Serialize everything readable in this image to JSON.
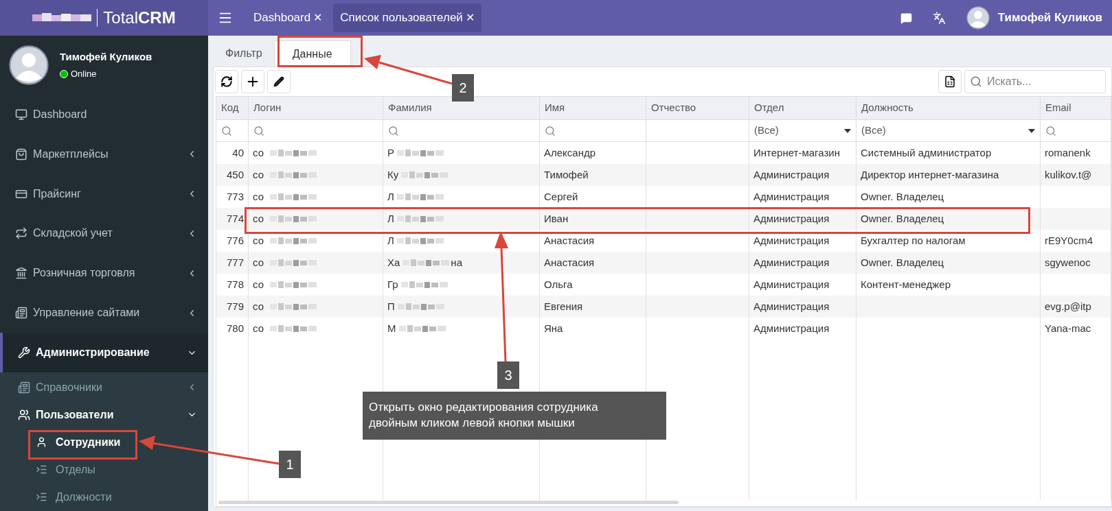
{
  "header": {
    "brand": "Total**CRM**",
    "tabs": [
      {
        "label": "Dashboard",
        "close": "✕",
        "selected": false
      },
      {
        "label": "Список пользователей",
        "close": "✕",
        "selected": true
      }
    ],
    "user": "Тимофей Куликов"
  },
  "sidebar": {
    "user": {
      "name": "Тимофей Куликов",
      "status": "Online"
    },
    "items": [
      {
        "label": "Dashboard"
      },
      {
        "label": "Маркетплейсы",
        "expanded": false
      },
      {
        "label": "Прайсинг",
        "expanded": false
      },
      {
        "label": "Складской учет",
        "expanded": false
      },
      {
        "label": "Розничная торговля",
        "expanded": false
      },
      {
        "label": "Управление сайтами",
        "expanded": false
      },
      {
        "label": "Администрирование",
        "expanded": true,
        "selected": true,
        "children": [
          {
            "label": "Справочники",
            "expanded": false,
            "selected": false
          },
          {
            "label": "Пользователи",
            "expanded": true,
            "selected": false,
            "children": [
              {
                "label": "Сотрудники",
                "selected": true
              },
              {
                "label": "Отделы",
                "selected": false
              },
              {
                "label": "Должности",
                "selected": false
              }
            ]
          }
        ]
      }
    ]
  },
  "page_tabs": [
    {
      "label": "Фильтр",
      "selected": false
    },
    {
      "label": "Данные",
      "selected": true
    }
  ],
  "search": {
    "placeholder": "Искать..."
  },
  "table": {
    "columns": [
      {
        "label": "Код",
        "filter": {
          "kind": "search"
        }
      },
      {
        "label": "Логин",
        "filter": {
          "kind": "search"
        }
      },
      {
        "label": "Фамилия",
        "filter": {
          "kind": "search"
        }
      },
      {
        "label": "Имя",
        "filter": {
          "kind": "search"
        }
      },
      {
        "label": "Отчество"
      },
      {
        "label": "Отдел",
        "filter": {
          "kind": "select",
          "value": "(Все)"
        }
      },
      {
        "label": "Должность",
        "filter": {
          "kind": "select",
          "value": "(Все)"
        }
      },
      {
        "label": "Email",
        "filter": {
          "kind": "search"
        }
      }
    ],
    "rows": [
      {
        "cells": [
          {
            "text": "40"
          },
          {
            "text": "со",
            "redacted": true
          },
          {
            "text": "Р",
            "redacted": true
          },
          {
            "text": "Александр"
          },
          {},
          {
            "text": "Интернет-магазин"
          },
          {
            "text": "Системный администратор"
          },
          {
            "text": "romanenk"
          }
        ]
      },
      {
        "cells": [
          {
            "text": "450"
          },
          {
            "text": "со",
            "redacted": true
          },
          {
            "text": "Ку",
            "redacted": true
          },
          {
            "text": "Тимофей"
          },
          {},
          {
            "text": "Администрация"
          },
          {
            "text": "Директор интернет-магазина"
          },
          {
            "text": "kulikov.t@"
          }
        ]
      },
      {
        "cells": [
          {
            "text": "773"
          },
          {
            "text": "со",
            "redacted": true
          },
          {
            "text": "Л",
            "redacted": true
          },
          {
            "text": "Сергей"
          },
          {},
          {
            "text": "Администрация"
          },
          {
            "text": "Owner. Владелец"
          },
          {}
        ]
      },
      {
        "cells": [
          {
            "text": "774"
          },
          {
            "text": "со",
            "redacted": true
          },
          {
            "text": "Л",
            "redacted": true
          },
          {
            "text": "Иван"
          },
          {},
          {
            "text": "Администрация"
          },
          {
            "text": "Owner. Владелец"
          },
          {}
        ]
      },
      {
        "cells": [
          {
            "text": "776"
          },
          {
            "text": "со",
            "redacted": true
          },
          {
            "text": "Л",
            "redacted": true
          },
          {
            "text": "Анастасия"
          },
          {},
          {
            "text": "Администрация"
          },
          {
            "text": "Бухгалтер по налогам"
          },
          {
            "text": "rE9Y0cm4"
          }
        ]
      },
      {
        "cells": [
          {
            "text": "777"
          },
          {
            "text": "со",
            "redacted": true
          },
          {
            "text": "Ха",
            "redacted": true,
            "tail": "на"
          },
          {
            "text": "Анастасия"
          },
          {},
          {
            "text": "Администрация"
          },
          {
            "text": "Owner. Владелец"
          },
          {
            "text": "sgywenoc"
          }
        ]
      },
      {
        "cells": [
          {
            "text": "778"
          },
          {
            "text": "со",
            "redacted": true
          },
          {
            "text": "Гр",
            "redacted": true
          },
          {
            "text": "Ольга"
          },
          {},
          {
            "text": "Администрация"
          },
          {
            "text": "Контент-менеджер"
          },
          {}
        ]
      },
      {
        "cells": [
          {
            "text": "779"
          },
          {
            "text": "со",
            "redacted": true
          },
          {
            "text": "П",
            "redacted": true
          },
          {
            "text": "Евгения"
          },
          {},
          {
            "text": "Администрация"
          },
          {},
          {
            "text": "evg.p@itp"
          }
        ]
      },
      {
        "cells": [
          {
            "text": "780"
          },
          {
            "text": "со",
            "redacted": true
          },
          {
            "text": "М",
            "redacted": true
          },
          {
            "text": "Яна"
          },
          {},
          {
            "text": "Администрация"
          },
          {},
          {
            "text": "Yana-mac"
          }
        ]
      }
    ]
  },
  "annotations": {
    "callouts": [
      {
        "label": "1"
      },
      {
        "label": "2"
      },
      {
        "label": "3"
      }
    ],
    "note": "Открыть окно редактирования сотрудника двойным кликом левой кнопки мышки"
  }
}
